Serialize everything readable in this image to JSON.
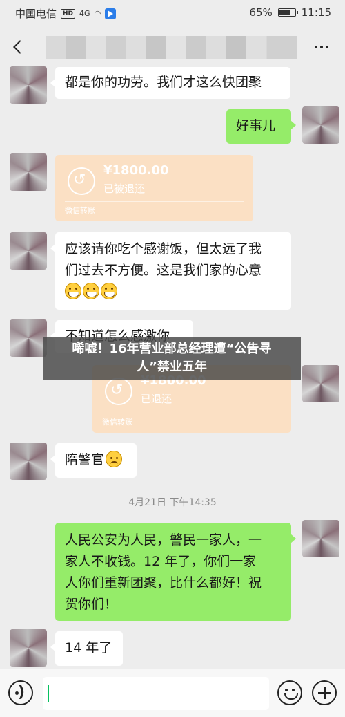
{
  "status_bar": {
    "carrier": "中国电信",
    "hd_badge": "HD",
    "network": "4G",
    "battery": "65%",
    "time": "11:15"
  },
  "header": {
    "back_icon": "back-arrow-icon",
    "more_icon": "more-icon"
  },
  "messages": [
    {
      "side": "left",
      "type": "text",
      "text": "都是你的功劳。我们才这么快团聚"
    },
    {
      "side": "right",
      "type": "text",
      "text": "好事儿"
    },
    {
      "side": "left",
      "type": "transfer",
      "amount": "¥1800.00",
      "status": "已被退还",
      "footer": "微信转账"
    },
    {
      "side": "left",
      "type": "text",
      "text_line1": "应该请你吃个感谢饭，但太远了我",
      "text_line2": "们过去不方便。这是我们家的心意",
      "emoji": "grin-emoji x3"
    },
    {
      "side": "left",
      "type": "text",
      "text": "不知道怎么感激你"
    },
    {
      "side": "right",
      "type": "transfer",
      "amount": "¥1800.00",
      "status": "已退还",
      "footer": "微信转账"
    },
    {
      "side": "left",
      "type": "text",
      "text": "隋警官",
      "emoji": "sad-emoji"
    },
    {
      "side": "right",
      "type": "text",
      "text_line1": "人民公安为人民，警民一家人，一",
      "text_line2": "家人不收钱。12 年了，你们一家",
      "text_line3": "人你们重新团聚，比什么都好！祝",
      "text_line4": "贺你们！"
    },
    {
      "side": "left",
      "type": "text",
      "text": "14 年了"
    }
  ],
  "timestamp": "4月21日 下午14:35",
  "overlay": {
    "line1": "唏嘘！16年营业部总经理遭“公告寻",
    "line2": "人”禁业五年"
  },
  "input_bar": {
    "voice_icon": "voice-icon",
    "emoji_icon": "emoji-icon",
    "plus_icon": "plus-icon",
    "value": ""
  }
}
